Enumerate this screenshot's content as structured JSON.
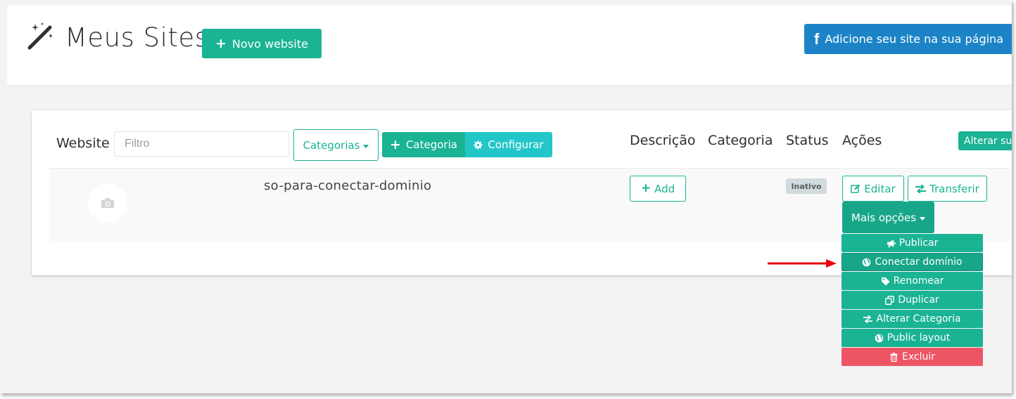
{
  "header": {
    "title": "Meus Sites",
    "new_website_label": "Novo website",
    "facebook_label": "Adicione seu site na sua página"
  },
  "toolbar": {
    "website_label": "Website",
    "filter_placeholder": "Filtro",
    "categorias_label": "Categorias",
    "categoria_label": "Categoria",
    "configurar_label": "Configurar"
  },
  "table": {
    "headers": {
      "descricao": "Descrição",
      "categoria": "Categoria",
      "status": "Status",
      "acoes": "Ações"
    },
    "alterar_label": "Alterar su",
    "rows": [
      {
        "site_name": "so-para-conectar-dominio",
        "add_label": "Add",
        "status": "Inativo",
        "editar_label": "Editar",
        "transferir_label": "Transferir",
        "mais_opcoes_label": "Mais opções"
      }
    ]
  },
  "dropdown": {
    "items": [
      {
        "label": "Publicar",
        "icon": "bullhorn-icon"
      },
      {
        "label": "Conectar domínio",
        "icon": "globe-icon",
        "active": true
      },
      {
        "label": "Renomear",
        "icon": "tag-icon"
      },
      {
        "label": "Duplicar",
        "icon": "copy-icon"
      },
      {
        "label": "Alterar Categoria",
        "icon": "exchange-icon"
      },
      {
        "label": "Public layout",
        "icon": "globe-icon"
      },
      {
        "label": "Excluir",
        "icon": "trash-icon"
      }
    ]
  },
  "colors": {
    "primary": "#1ab394",
    "info": "#23c6c8",
    "facebook": "#1c84c6",
    "danger": "#ed5565",
    "arrow": "#e8000b"
  }
}
